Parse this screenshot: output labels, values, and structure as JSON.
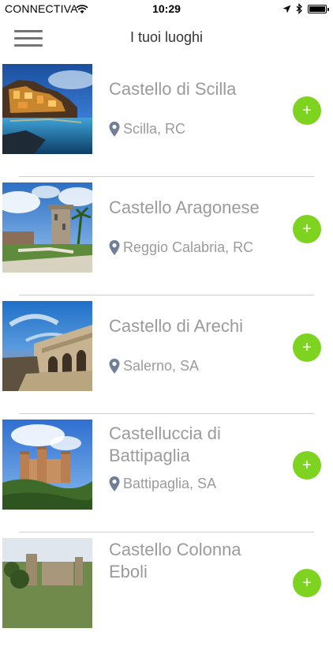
{
  "status_bar": {
    "carrier": "CONNECTIVA",
    "time": "10:29"
  },
  "nav": {
    "title": "I tuoi luoghi"
  },
  "places": [
    {
      "name": "Castello di Scilla",
      "location": "Scilla, RC",
      "add_label": "+"
    },
    {
      "name": "Castello Aragonese",
      "location": "Reggio Calabria, RC",
      "add_label": "+"
    },
    {
      "name": "Castello di Arechi",
      "location": "Salerno, SA",
      "add_label": "+"
    },
    {
      "name": "Castelluccia di Battipaglia",
      "location": "Battipaglia, SA",
      "add_label": "+"
    },
    {
      "name": "Castello Colonna Eboli",
      "location": "",
      "add_label": "+"
    }
  ],
  "colors": {
    "accent": "#7ed321",
    "text_muted": "#9b9b9b",
    "divider": "#cfcfcf"
  }
}
